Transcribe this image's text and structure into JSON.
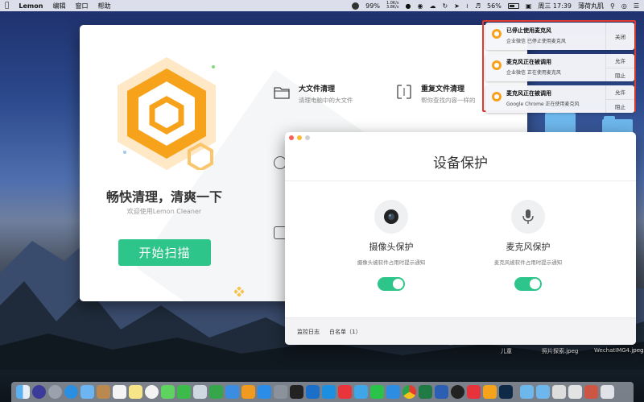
{
  "menubar": {
    "app_name": "Lemon",
    "menus": [
      "编辑",
      "窗口",
      "帮助"
    ],
    "cpu_percent": "99%",
    "net_up": "1.0K/s",
    "net_down": "3.8K/s",
    "battery_percent": "56%",
    "clock": "周三 17:39",
    "user": "薄荷丸肌"
  },
  "main_window": {
    "slogan": "畅快清理，清爽一下",
    "welcome": "欢迎使用Lemon Cleaner",
    "scan_button": "开始扫描",
    "features": [
      {
        "title": "大文件清理",
        "subtitle": "清理电脑中的大文件"
      },
      {
        "title": "重复文件清理",
        "subtitle": "帮你查找内容一样的"
      }
    ]
  },
  "device_window": {
    "title": "设备保护",
    "camera": {
      "title": "摄像头保护",
      "subtitle": "摄像头被软件占用时提示通知",
      "enabled": true
    },
    "microphone": {
      "title": "麦克风保护",
      "subtitle": "麦克风被软件占用时提示通知",
      "enabled": true
    },
    "footer_log": "监控日志",
    "footer_whitelist": "白名单（1）"
  },
  "notifications": [
    {
      "title": "已停止使用麦克风",
      "subtitle": "企业微信 已停止使用麦克风",
      "actions": [
        "关闭"
      ]
    },
    {
      "title": "麦克风正在被调用",
      "subtitle": "企业微信 正在使用麦克风",
      "actions": [
        "允许",
        "阻止"
      ]
    },
    {
      "title": "麦克风正在被调用",
      "subtitle": "Google Chrome 正在使用麦克风",
      "actions": [
        "允许",
        "阻止"
      ]
    }
  ],
  "desktop": {
    "files": [
      "儿童",
      "照片探索.jpeg",
      "WechatIMG4.jpeg"
    ]
  },
  "colors": {
    "accent_green": "#2dc58a",
    "logo_orange": "#f6a21b",
    "highlight_red": "#e33b2f"
  }
}
